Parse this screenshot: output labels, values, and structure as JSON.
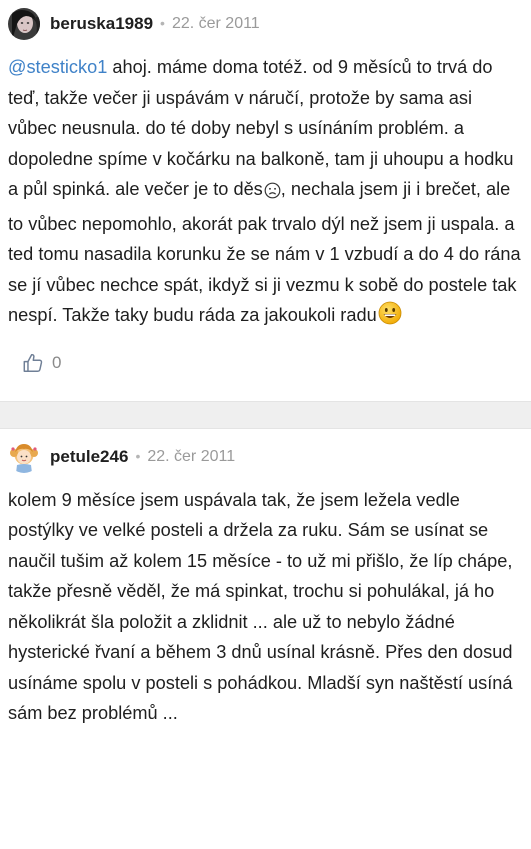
{
  "posts": [
    {
      "username": "beruska1989",
      "date": "22. čer 2011",
      "mention": "@stesticko1",
      "text": " ahoj. máme doma totéž. od 9 měsíců to trvá do teď, takže večer ji uspávám v náručí, protože by sama asi vůbec neusnula. do té doby nebyl s usínáním problém. a dopoledne spíme v kočárku na balkoně, tam ji uhoupu a hodku a půl spinká. ale večer je to děs",
      "text_after_sad": ", nechala jsem ji i brečet, ale to vůbec nepomohlo, akorát pak trvalo dýl než jsem ji uspala. a ted tomu nasadila korunku že se nám v 1 vzbudí a do 4 do rána se jí vůbec nechce spát, ikdyž si ji vezmu k sobě do postele tak nespí. Takže taky budu ráda za jakoukoli radu",
      "like_count": "0",
      "icons": {
        "sad": "sad-face-emoji",
        "grin": "grinning-face-emoji",
        "like": "thumbs-up-icon"
      }
    },
    {
      "username": "petule246",
      "date": "22. čer 2011",
      "text": "kolem 9 měsíce jsem uspávala tak, že jsem ležela vedle postýlky ve velké posteli a držela za ruku. Sám se usínat se naučil tušim až kolem 15 měsíce - to už mi přišlo, že líp chápe, takže přesně věděl, že má spinkat, trochu si pohulákal, já ho několikrát šla položit a zklidnit ... ale už to nebylo žádné hysterické řvaní a během 3 dnů usínal krásně. Přes den dosud usínáme spolu v posteli s pohádkou. Mladší syn naštěstí usíná sám bez problémů ..."
    }
  ],
  "separator_char": "•",
  "colors": {
    "mention": "#3f82c8",
    "date": "#9a9a9a",
    "separator_bg": "#efefef",
    "like_icon": "#6f7f96",
    "emoji_yellow": "#f5c518"
  }
}
